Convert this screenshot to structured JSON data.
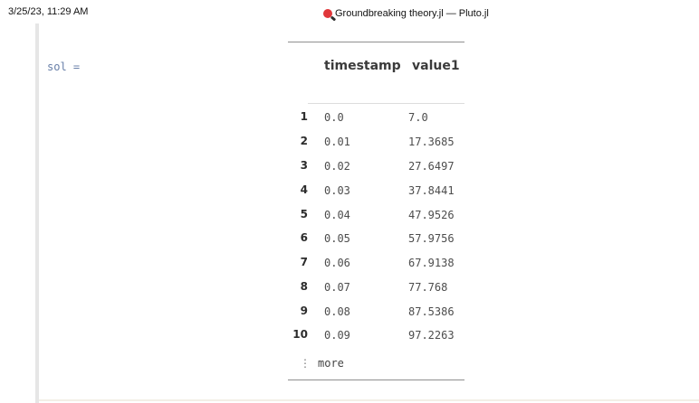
{
  "print_header": {
    "date": "3/25/23, 11:29 AM",
    "title": "Groundbreaking theory.jl — Pluto.jl",
    "icon": "pluto-logo-icon"
  },
  "cell": {
    "variable_label": "sol ="
  },
  "table": {
    "columns": [
      "timestamp",
      "value1"
    ],
    "rows": [
      {
        "index": "1",
        "timestamp": "0.0",
        "value1": "7.0"
      },
      {
        "index": "2",
        "timestamp": "0.01",
        "value1": "17.3685"
      },
      {
        "index": "3",
        "timestamp": "0.02",
        "value1": "27.6497"
      },
      {
        "index": "4",
        "timestamp": "0.03",
        "value1": "37.8441"
      },
      {
        "index": "5",
        "timestamp": "0.04",
        "value1": "47.9526"
      },
      {
        "index": "6",
        "timestamp": "0.05",
        "value1": "57.9756"
      },
      {
        "index": "7",
        "timestamp": "0.06",
        "value1": "67.9138"
      },
      {
        "index": "8",
        "timestamp": "0.07",
        "value1": "77.768"
      },
      {
        "index": "9",
        "timestamp": "0.08",
        "value1": "87.5386"
      },
      {
        "index": "10",
        "timestamp": "0.09",
        "value1": "97.2263"
      }
    ],
    "more_label": "more",
    "more_icon": "vertical-ellipsis-icon"
  }
}
